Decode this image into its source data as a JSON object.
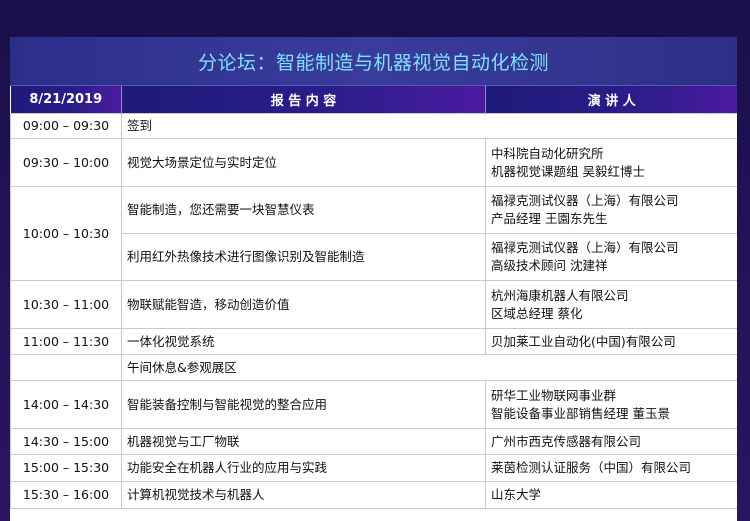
{
  "title": "分论坛：智能制造与机器视觉自动化检测",
  "header": {
    "date": "8/21/2019",
    "topic": "报 告 内 容",
    "speaker": "演 讲 人"
  },
  "rows": [
    {
      "time": "09:00 – 09:30",
      "topic": "签到",
      "speaker": ""
    },
    {
      "time": "09:30 – 10:00",
      "topic": "视觉大场景定位与实时定位",
      "speaker": "中科院自动化研究所\n机器视觉课题组 吴毅红博士"
    },
    {
      "time": "10:00 – 10:30",
      "topic": "智能制造，您还需要一块智慧仪表",
      "speaker": "福禄克测试仪器（上海）有限公司\n产品经理 王園东先生"
    },
    {
      "time": "",
      "topic": "利用红外热像技术进行图像识别及智能制造",
      "speaker": "福禄克测试仪器（上海）有限公司\n高级技术顾问 沈建祥"
    },
    {
      "time": "10:30 – 11:00",
      "topic": "物联赋能智造，移动创造价值",
      "speaker": "杭州海康机器人有限公司\n区域总经理 蔡化"
    },
    {
      "time": "11:00 – 11:30",
      "topic": "一体化视觉系统",
      "speaker": "贝加莱工业自动化(中国)有限公司"
    },
    {
      "time": "",
      "topic": "午间休息&参观展区",
      "speaker": ""
    },
    {
      "time": "14:00 – 14:30",
      "topic": "智能装备控制与智能视觉的整合应用",
      "speaker": "研华工业物联网事业群\n智能设备事业部销售经理 董玉景"
    },
    {
      "time": "14:30 – 15:00",
      "topic": "机器视觉与工厂物联",
      "speaker": "广州市西克传感器有限公司"
    },
    {
      "time": "15:00 – 15:30",
      "topic": "功能安全在机器人行业的应用与实践",
      "speaker": "莱茵检测认证服务（中国）有限公司"
    },
    {
      "time": "15:30 – 16:00",
      "topic": "计算机视觉技术与机器人",
      "speaker": "山东大学"
    }
  ]
}
